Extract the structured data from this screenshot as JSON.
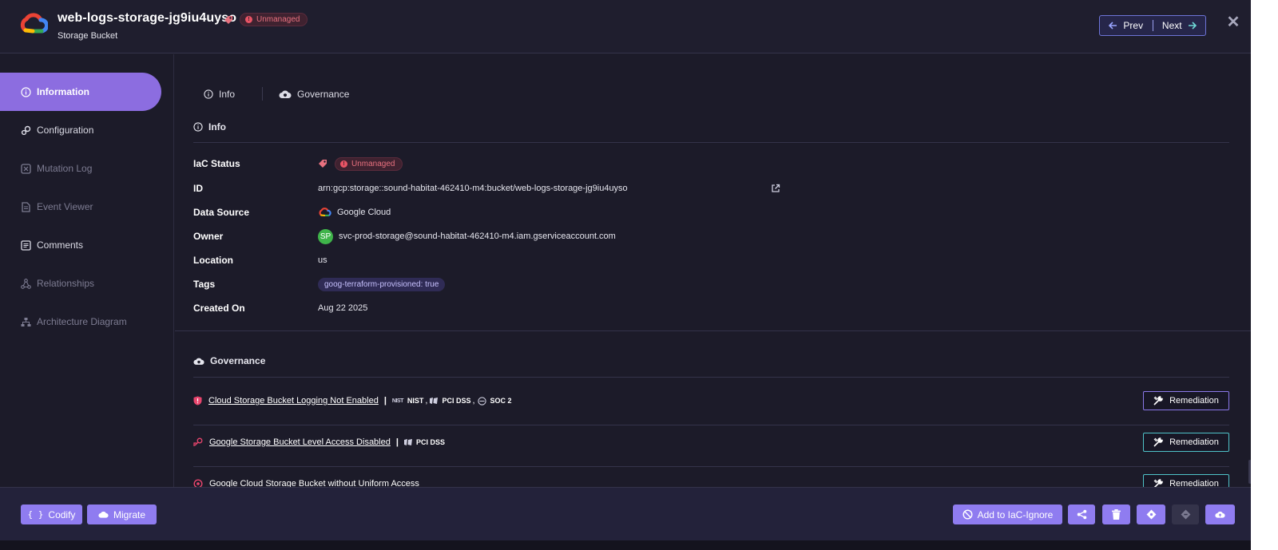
{
  "header": {
    "title": "web-logs-storage-jg9iu4uyso",
    "subtitle": "Storage Bucket",
    "badge": "Unmanaged",
    "prev_label": "Prev",
    "next_label": "Next",
    "close_label": "✕"
  },
  "sidebar": {
    "items": [
      {
        "label": "Information",
        "icon": "info-icon",
        "state": "active"
      },
      {
        "label": "Configuration",
        "icon": "gear-icon",
        "state": "normal"
      },
      {
        "label": "Mutation Log",
        "icon": "mutation-icon",
        "state": "disabled"
      },
      {
        "label": "Event Viewer",
        "icon": "document-icon",
        "state": "disabled"
      },
      {
        "label": "Comments",
        "icon": "comments-icon",
        "state": "normal"
      },
      {
        "label": "Relationships",
        "icon": "relationships-icon",
        "state": "disabled"
      },
      {
        "label": "Architecture Diagram",
        "icon": "hierarchy-icon",
        "state": "disabled"
      }
    ]
  },
  "tabs": [
    {
      "label": "Info",
      "icon": "info-icon"
    },
    {
      "label": "Governance",
      "icon": "cloud-shield-icon"
    }
  ],
  "info": {
    "heading": "Info",
    "rows": {
      "iac_status": {
        "label": "IaC Status",
        "value": "Unmanaged"
      },
      "id": {
        "label": "ID",
        "value": "arn:gcp:storage::sound-habitat-462410-m4:bucket/web-logs-storage-jg9iu4uyso"
      },
      "data_source": {
        "label": "Data Source",
        "value": "Google Cloud"
      },
      "owner": {
        "label": "Owner",
        "avatar": "SP",
        "value": "svc-prod-storage@sound-habitat-462410-m4.iam.gserviceaccount.com"
      },
      "location": {
        "label": "Location",
        "value": "us"
      },
      "tags": {
        "label": "Tags",
        "value": "goog-terraform-provisioned: true"
      },
      "created_on": {
        "label": "Created On",
        "value": "Aug 22 2025"
      }
    }
  },
  "governance": {
    "heading": "Governance",
    "items": [
      {
        "title": "Cloud Storage Bucket Logging Not Enabled",
        "icon": "shield-alert-icon",
        "frameworks": [
          {
            "logo": "NIST",
            "label": "NIST"
          },
          {
            "logo": "pci-icon",
            "label": "PCI DSS"
          },
          {
            "logo": "soc-icon",
            "label": "SOC 2"
          }
        ],
        "action": "Remediation"
      },
      {
        "title": "Google Storage Bucket Level Access Disabled",
        "icon": "access-alert-icon",
        "frameworks": [
          {
            "logo": "pci-icon",
            "label": "PCI DSS"
          }
        ],
        "action": "Remediation"
      },
      {
        "title": "Google Cloud Storage Bucket without Uniform Access",
        "icon": "uniform-alert-icon",
        "frameworks": [],
        "action": "Remediation"
      }
    ]
  },
  "footer": {
    "codify": "Codify",
    "migrate": "Migrate",
    "iac_ignore": "Add to IaC-Ignore",
    "icon_buttons": [
      "share-icon",
      "trash-icon",
      "diamond-icon",
      "diamond-disabled-icon",
      "cloud-upload-icon"
    ]
  },
  "colors": {
    "accent": "#8c6de0",
    "button": "#8f7cf0",
    "danger": "#e85465",
    "background": "#1c1b29"
  }
}
